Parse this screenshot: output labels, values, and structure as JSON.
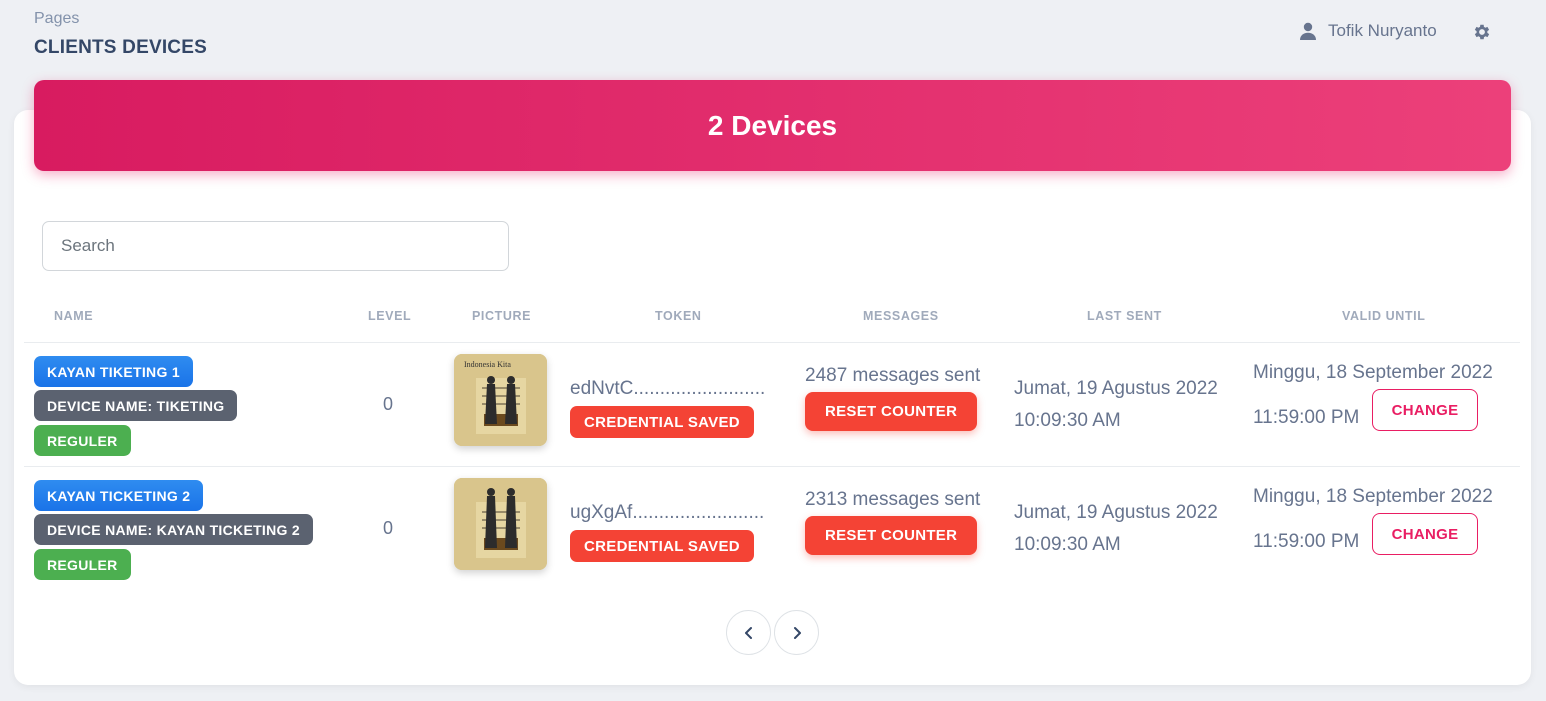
{
  "breadcrumb": {
    "parent": "Pages"
  },
  "page_title": "CLIENTS DEVICES",
  "user": {
    "name": "Tofik Nuryanto",
    "icon": "user-icon"
  },
  "settings": {
    "icon": "gear-icon"
  },
  "banner": {
    "title": "2 Devices"
  },
  "search": {
    "placeholder": "Search",
    "value": ""
  },
  "table": {
    "headers": [
      "NAME",
      "LEVEL",
      "PICTURE",
      "TOKEN",
      "MESSAGES",
      "LAST SENT",
      "VALID UNTIL"
    ],
    "rows": [
      {
        "name": "KAYAN TIKETING 1",
        "device_name": "DEVICE NAME: TIKETING",
        "type": "REGULER",
        "level": "0",
        "picture_caption": "Indonesia Kita",
        "token": "edNvtC.........................",
        "credential": "CREDENTIAL SAVED",
        "messages": "2487 messages sent",
        "reset_label": "RESET COUNTER",
        "last_sent_date": "Jumat, 19 Agustus 2022",
        "last_sent_time": "10:09:30 AM",
        "valid_date": "Minggu, 18 September 2022",
        "valid_time": "11:59:00 PM",
        "change_label": "CHANGE"
      },
      {
        "name": "KAYAN TICKETING 2",
        "device_name": "DEVICE NAME: KAYAN TICKETING 2",
        "type": "REGULER",
        "level": "0",
        "token": "ugXgAf.........................",
        "credential": "CREDENTIAL SAVED",
        "messages": "2313 messages sent",
        "reset_label": "RESET COUNTER",
        "last_sent_date": "Jumat, 19 Agustus 2022",
        "last_sent_time": "10:09:30 AM",
        "valid_date": "Minggu, 18 September 2022",
        "valid_time": "11:59:00 PM",
        "change_label": "CHANGE"
      }
    ]
  },
  "pagination": {
    "prev_icon": "chevron-left-icon",
    "next_icon": "chevron-right-icon"
  },
  "colors": {
    "primary": "#e91e63",
    "danger": "#f44335",
    "info": "#1a73e8",
    "success": "#4caf50",
    "dark": "#5b6270"
  }
}
